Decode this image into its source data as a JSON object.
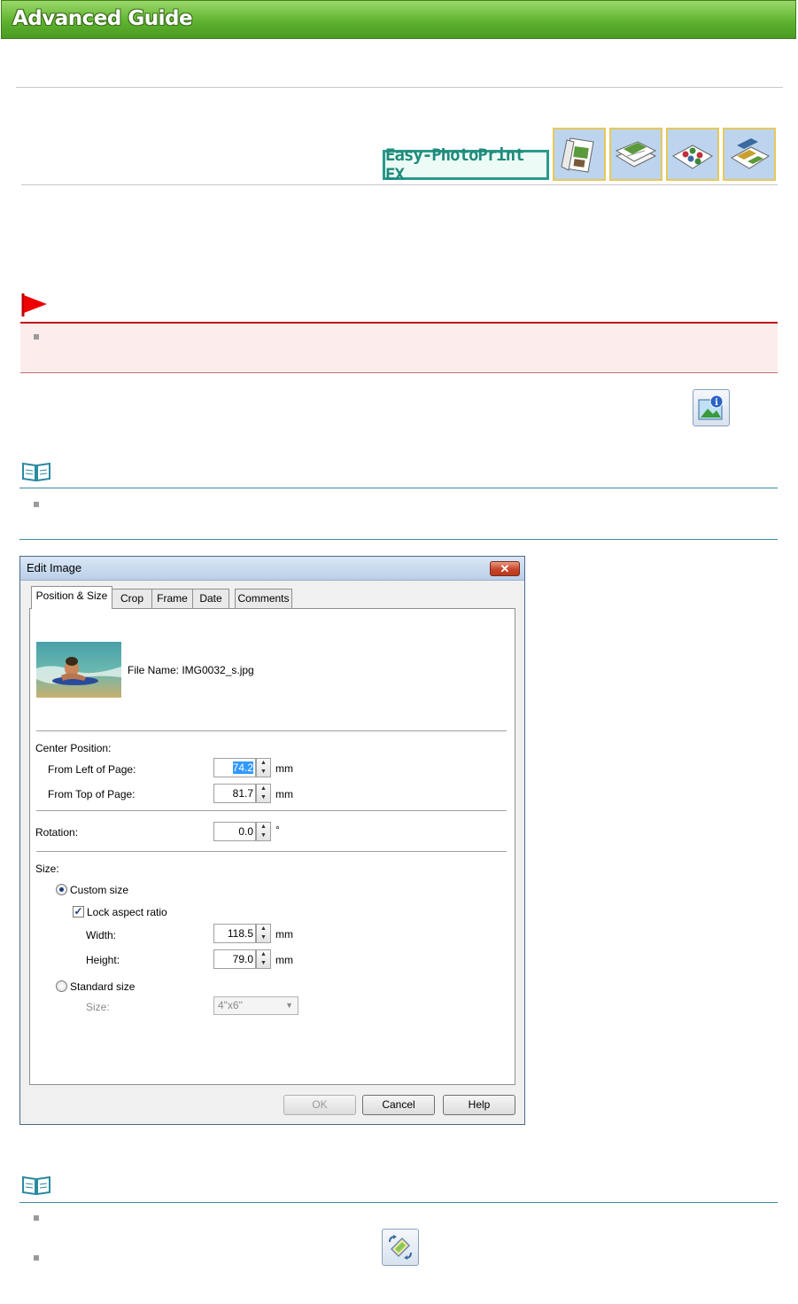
{
  "header": {
    "title": "Advanced Guide"
  },
  "product": {
    "badge": "Easy-PhotoPrint EX",
    "icons": [
      "album-icon",
      "calendar-icon",
      "stickers-icon",
      "layout-print-icon"
    ]
  },
  "dialog": {
    "title": "Edit Image",
    "close": "✕",
    "tabs": [
      "Position & Size",
      "Crop",
      "Frame",
      "Date",
      "Comments"
    ],
    "file_name_label": "File Name: IMG0032_s.jpg",
    "center_position": {
      "label": "Center Position:",
      "left_label": "From Left of Page:",
      "left_value": "74.2",
      "top_label": "From Top of Page:",
      "top_value": "81.7",
      "unit": "mm"
    },
    "rotation": {
      "label": "Rotation:",
      "value": "0.0",
      "unit": "°"
    },
    "size": {
      "label": "Size:",
      "custom": "Custom size",
      "lock": "Lock aspect ratio",
      "width_label": "Width:",
      "width_value": "118.5",
      "height_label": "Height:",
      "height_value": "79.0",
      "unit": "mm",
      "standard": "Standard size",
      "std_size_label": "Size:",
      "std_size_value": "4\"x6\""
    },
    "buttons": {
      "ok": "OK",
      "cancel": "Cancel",
      "help": "Help"
    }
  },
  "colors": {
    "banner": "#5fb32f",
    "caution": "#c01010",
    "note_line": "#3a8aa0"
  }
}
